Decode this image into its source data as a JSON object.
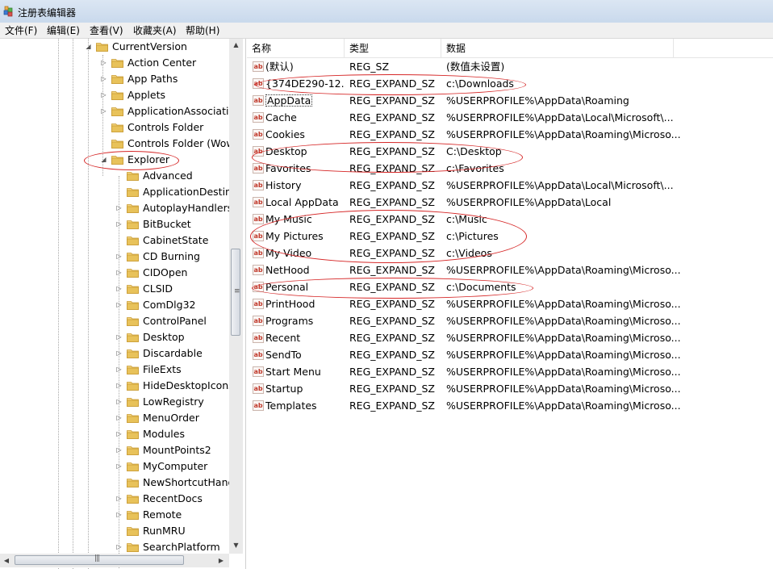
{
  "window": {
    "title": "注册表编辑器"
  },
  "menu": [
    "文件(F)",
    "编辑(E)",
    "查看(V)",
    "收藏夹(A)",
    "帮助(H)"
  ],
  "tree": {
    "items": [
      {
        "label": "CurrentVersion",
        "level": 0,
        "state": "expanded"
      },
      {
        "label": "Action Center",
        "level": 1,
        "state": "collapsed"
      },
      {
        "label": "App Paths",
        "level": 1,
        "state": "collapsed"
      },
      {
        "label": "Applets",
        "level": 1,
        "state": "collapsed"
      },
      {
        "label": "ApplicationAssociatio",
        "level": 1,
        "state": "collapsed"
      },
      {
        "label": "Controls Folder",
        "level": 1,
        "state": "leaf"
      },
      {
        "label": "Controls Folder (Wow",
        "level": 1,
        "state": "leaf"
      },
      {
        "label": "Explorer",
        "level": 1,
        "state": "expanded"
      },
      {
        "label": "Advanced",
        "level": 2,
        "state": "leaf"
      },
      {
        "label": "ApplicationDestina",
        "level": 2,
        "state": "leaf"
      },
      {
        "label": "AutoplayHandlers",
        "level": 2,
        "state": "collapsed"
      },
      {
        "label": "BitBucket",
        "level": 2,
        "state": "collapsed"
      },
      {
        "label": "CabinetState",
        "level": 2,
        "state": "leaf"
      },
      {
        "label": "CD Burning",
        "level": 2,
        "state": "collapsed"
      },
      {
        "label": "CIDOpen",
        "level": 2,
        "state": "collapsed"
      },
      {
        "label": "CLSID",
        "level": 2,
        "state": "collapsed"
      },
      {
        "label": "ComDlg32",
        "level": 2,
        "state": "collapsed"
      },
      {
        "label": "ControlPanel",
        "level": 2,
        "state": "leaf"
      },
      {
        "label": "Desktop",
        "level": 2,
        "state": "collapsed"
      },
      {
        "label": "Discardable",
        "level": 2,
        "state": "collapsed"
      },
      {
        "label": "FileExts",
        "level": 2,
        "state": "collapsed"
      },
      {
        "label": "HideDesktopIcons",
        "level": 2,
        "state": "collapsed"
      },
      {
        "label": "LowRegistry",
        "level": 2,
        "state": "collapsed"
      },
      {
        "label": "MenuOrder",
        "level": 2,
        "state": "collapsed"
      },
      {
        "label": "Modules",
        "level": 2,
        "state": "collapsed"
      },
      {
        "label": "MountPoints2",
        "level": 2,
        "state": "collapsed"
      },
      {
        "label": "MyComputer",
        "level": 2,
        "state": "collapsed"
      },
      {
        "label": "NewShortcutHand",
        "level": 2,
        "state": "leaf"
      },
      {
        "label": "RecentDocs",
        "level": 2,
        "state": "collapsed"
      },
      {
        "label": "Remote",
        "level": 2,
        "state": "collapsed"
      },
      {
        "label": "RunMRU",
        "level": 2,
        "state": "leaf"
      },
      {
        "label": "SearchPlatform",
        "level": 2,
        "state": "collapsed"
      }
    ]
  },
  "list": {
    "columns": [
      "名称",
      "类型",
      "数据"
    ],
    "rows": [
      {
        "name": "(默认)",
        "type": "REG_SZ",
        "data": "(数值未设置)"
      },
      {
        "name": "{374DE290-12...",
        "type": "REG_EXPAND_SZ",
        "data": "c:\\Downloads"
      },
      {
        "name": "AppData",
        "type": "REG_EXPAND_SZ",
        "data": "%USERPROFILE%\\AppData\\Roaming",
        "focused": true
      },
      {
        "name": "Cache",
        "type": "REG_EXPAND_SZ",
        "data": "%USERPROFILE%\\AppData\\Local\\Microsoft\\..."
      },
      {
        "name": "Cookies",
        "type": "REG_EXPAND_SZ",
        "data": "%USERPROFILE%\\AppData\\Roaming\\Microso..."
      },
      {
        "name": "Desktop",
        "type": "REG_EXPAND_SZ",
        "data": "C:\\Desktop"
      },
      {
        "name": "Favorites",
        "type": "REG_EXPAND_SZ",
        "data": "c:\\Favorites"
      },
      {
        "name": "History",
        "type": "REG_EXPAND_SZ",
        "data": "%USERPROFILE%\\AppData\\Local\\Microsoft\\..."
      },
      {
        "name": "Local AppData",
        "type": "REG_EXPAND_SZ",
        "data": "%USERPROFILE%\\AppData\\Local"
      },
      {
        "name": "My Music",
        "type": "REG_EXPAND_SZ",
        "data": "c:\\Music"
      },
      {
        "name": "My Pictures",
        "type": "REG_EXPAND_SZ",
        "data": "c:\\Pictures"
      },
      {
        "name": "My Video",
        "type": "REG_EXPAND_SZ",
        "data": "c:\\Videos"
      },
      {
        "name": "NetHood",
        "type": "REG_EXPAND_SZ",
        "data": "%USERPROFILE%\\AppData\\Roaming\\Microso..."
      },
      {
        "name": "Personal",
        "type": "REG_EXPAND_SZ",
        "data": "c:\\Documents"
      },
      {
        "name": "PrintHood",
        "type": "REG_EXPAND_SZ",
        "data": "%USERPROFILE%\\AppData\\Roaming\\Microso..."
      },
      {
        "name": "Programs",
        "type": "REG_EXPAND_SZ",
        "data": "%USERPROFILE%\\AppData\\Roaming\\Microso..."
      },
      {
        "name": "Recent",
        "type": "REG_EXPAND_SZ",
        "data": "%USERPROFILE%\\AppData\\Roaming\\Microso..."
      },
      {
        "name": "SendTo",
        "type": "REG_EXPAND_SZ",
        "data": "%USERPROFILE%\\AppData\\Roaming\\Microso..."
      },
      {
        "name": "Start Menu",
        "type": "REG_EXPAND_SZ",
        "data": "%USERPROFILE%\\AppData\\Roaming\\Microso..."
      },
      {
        "name": "Startup",
        "type": "REG_EXPAND_SZ",
        "data": "%USERPROFILE%\\AppData\\Roaming\\Microso..."
      },
      {
        "name": "Templates",
        "type": "REG_EXPAND_SZ",
        "data": "%USERPROFILE%\\AppData\\Roaming\\Microso..."
      }
    ]
  },
  "icons": {
    "app": "registry-cube-icon",
    "folder": "folder-icon",
    "value": "string-value-ab-icon",
    "expand": "expand-arrow-icon",
    "collapse": "collapse-arrow-icon"
  },
  "colors": {
    "annotation": "#d62828",
    "folder": "#e8c25a",
    "value_icon": "#c0392b"
  }
}
